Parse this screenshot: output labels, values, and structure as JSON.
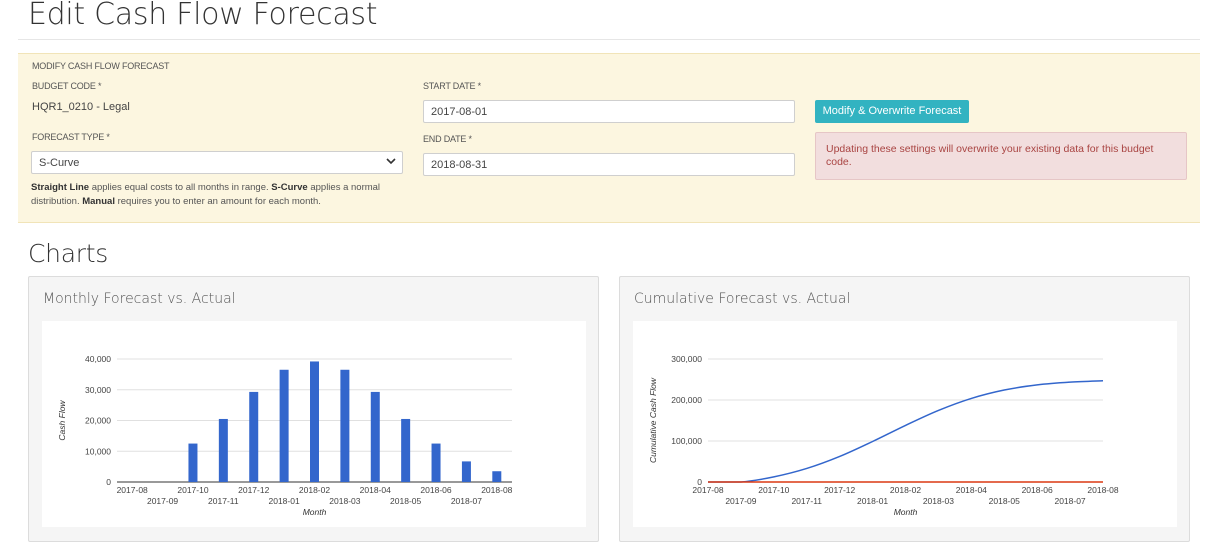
{
  "page": {
    "title": "Edit Cash Flow Forecast"
  },
  "form": {
    "section_label": "MODIFY CASH FLOW FORECAST",
    "budget_code_label": "BUDGET CODE *",
    "budget_code_value": "HQR1_0210 - Legal",
    "forecast_type_label": "FORECAST TYPE *",
    "forecast_type_value": "S-Curve",
    "start_date_label": "START DATE *",
    "start_date_value": "2017-08-01",
    "end_date_label": "END DATE *",
    "end_date_value": "2018-08-31",
    "help_strong_1": "Straight Line",
    "help_text_1": " applies equal costs to all months in range. ",
    "help_strong_2": "S-Curve",
    "help_text_2": " applies a normal distribution. ",
    "help_strong_3": "Manual",
    "help_text_3": " requires you to enter an amount for each month.",
    "submit_label": "Modify & Overwrite Forecast",
    "warning_text": "Updating these settings will overwrite your existing data for this budget code."
  },
  "charts_section": {
    "title": "Charts"
  },
  "colors": {
    "bar": "#3366cc",
    "forecast_line": "#3366cc",
    "actual_line": "#dc3912",
    "button": "#32b3c1",
    "panel": "#fcf6e0"
  },
  "chart_data": [
    {
      "type": "bar",
      "title": "Monthly Forecast vs. Actual",
      "xlabel": "Month",
      "ylabel": "Cash Flow",
      "ylim": [
        0,
        40000
      ],
      "yticks": [
        "0",
        "10,000",
        "20,000",
        "30,000",
        "40,000"
      ],
      "categories": [
        "2017-08",
        "2017-09",
        "2017-10",
        "2017-11",
        "2017-12",
        "2018-01",
        "2018-02",
        "2018-03",
        "2018-04",
        "2018-05",
        "2018-06",
        "2018-07",
        "2018-08"
      ],
      "series": [
        {
          "values": [
            0,
            0,
            12500,
            20500,
            29300,
            36500,
            39200,
            36500,
            29300,
            20500,
            12500,
            6700,
            3500
          ]
        }
      ],
      "grid": true
    },
    {
      "type": "line",
      "title": "Cumulative Forecast vs. Actual",
      "xlabel": "Month",
      "ylabel": "Cumulative Cash Flow",
      "ylim": [
        0,
        300000
      ],
      "yticks": [
        "0",
        "100,000",
        "200,000",
        "300,000"
      ],
      "categories": [
        "2017-08",
        "2017-09",
        "2017-10",
        "2017-11",
        "2017-12",
        "2018-01",
        "2018-02",
        "2018-03",
        "2018-04",
        "2018-05",
        "2018-06",
        "2018-07",
        "2018-08"
      ],
      "series": [
        {
          "values": [
            0,
            0,
            12500,
            33000,
            62300,
            98800,
            138000,
            174500,
            203800,
            224300,
            236800,
            243500,
            247000
          ]
        },
        {
          "values": [
            0,
            0,
            0,
            0,
            0,
            0,
            0,
            0,
            0,
            0,
            0,
            0,
            0
          ]
        }
      ],
      "grid": true
    }
  ]
}
